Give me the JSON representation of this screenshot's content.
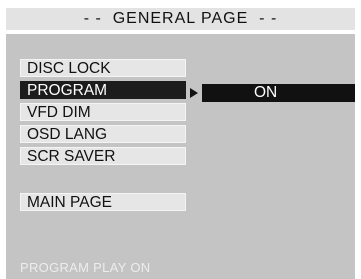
{
  "header": {
    "title": "- -  GENERAL PAGE  - -"
  },
  "menu": {
    "items": [
      {
        "label": "DISC LOCK",
        "selected": false
      },
      {
        "label": "PROGRAM",
        "selected": true
      },
      {
        "label": "VFD DIM",
        "selected": false
      },
      {
        "label": "OSD LANG",
        "selected": false
      },
      {
        "label": "SCR SAVER",
        "selected": false
      }
    ],
    "main_page_label": "MAIN PAGE"
  },
  "option": {
    "value": "ON"
  },
  "status": {
    "text": "PROGRAM PLAY ON"
  },
  "colors": {
    "header_bg": "#e3e3e3",
    "panel_bg": "#c4c4c4",
    "item_bg": "#e6e6e6",
    "selected_bg": "#1c1c1c",
    "status_text": "#ededed"
  },
  "icons": {
    "selection_pointer": "right-triangle-icon"
  }
}
